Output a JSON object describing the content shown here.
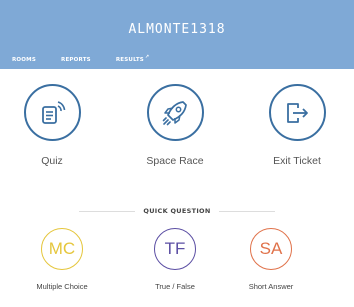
{
  "header": {
    "room_name": "ALMONTE1318",
    "tabs": [
      {
        "label": "ROOMS"
      },
      {
        "label": "REPORTS"
      },
      {
        "label": "RESULTS",
        "external": "↗"
      }
    ],
    "bg_color": "#7fa9d6"
  },
  "activities": [
    {
      "label": "Quiz",
      "icon": "quiz-icon"
    },
    {
      "label": "Space Race",
      "icon": "rocket-icon"
    },
    {
      "label": "Exit Ticket",
      "icon": "exit-door-icon"
    }
  ],
  "quick_question": {
    "heading": "QUICK QUESTION",
    "items": [
      {
        "abbr": "MC",
        "label": "Multiple Choice",
        "color": "#e5c63c"
      },
      {
        "abbr": "TF",
        "label": "True / False",
        "color": "#5b4ea3"
      },
      {
        "abbr": "SA",
        "label": "Short Answer",
        "color": "#e0724a"
      }
    ]
  },
  "activity_color": "#3a6fa1"
}
